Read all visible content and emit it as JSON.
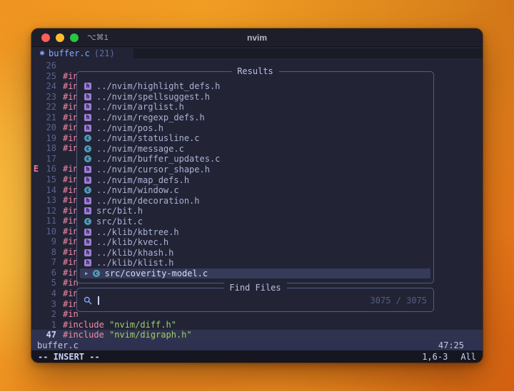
{
  "colors": {
    "bg": "#222436",
    "titlebar": "#1d1e2a",
    "tabfill": "#191b26",
    "cmdbg": "#15161f",
    "statusbg": "#2e3250",
    "border": "#545c7e",
    "fg": "#c8d3f5",
    "dim": "#636da6",
    "linenr": "#5a638c",
    "pink": "#f38ba8",
    "green": "#9ece6a",
    "red": "#f7768e",
    "blue": "#82aaff",
    "selbg": "#363b59",
    "cursorline": "#2f334d",
    "icon_c": "#519aba",
    "icon_h": "#9d7cd8",
    "light_close": "#ff5f57",
    "light_min": "#febc2e",
    "light_zoom": "#28c840"
  },
  "titlebar": {
    "title": "nvim",
    "shortcut": "⌥⌘1"
  },
  "tabline": {
    "icon": "◉",
    "label": "buffer.c",
    "count": "(21)"
  },
  "editor": {
    "lines": [
      {
        "n": "26",
        "parts": []
      },
      {
        "n": "25",
        "parts": [
          {
            "t": "#in",
            "c": "pp"
          }
        ]
      },
      {
        "n": "24",
        "parts": [
          {
            "t": "#in",
            "c": "pp"
          }
        ]
      },
      {
        "n": "23",
        "parts": [
          {
            "t": "#in",
            "c": "pp"
          }
        ]
      },
      {
        "n": "22",
        "parts": [
          {
            "t": "#in",
            "c": "pp"
          }
        ]
      },
      {
        "n": "21",
        "parts": [
          {
            "t": "#in",
            "c": "pp"
          }
        ]
      },
      {
        "n": "20",
        "parts": [
          {
            "t": "#in",
            "c": "pp"
          }
        ]
      },
      {
        "n": "19",
        "parts": [
          {
            "t": "#in",
            "c": "pp"
          }
        ]
      },
      {
        "n": "18",
        "parts": [
          {
            "t": "#in",
            "c": "pp"
          }
        ]
      },
      {
        "n": "17",
        "parts": []
      },
      {
        "n": "16",
        "sign": "E",
        "parts": [
          {
            "t": "#in",
            "c": "pp"
          }
        ]
      },
      {
        "n": "15",
        "parts": [
          {
            "t": "#in",
            "c": "pp"
          }
        ]
      },
      {
        "n": "14",
        "parts": [
          {
            "t": "#in",
            "c": "pp"
          }
        ]
      },
      {
        "n": "13",
        "parts": [
          {
            "t": "#in",
            "c": "pp"
          }
        ]
      },
      {
        "n": "12",
        "parts": [
          {
            "t": "#in",
            "c": "pp"
          }
        ]
      },
      {
        "n": "11",
        "parts": [
          {
            "t": "#in",
            "c": "pp"
          }
        ]
      },
      {
        "n": "10",
        "parts": [
          {
            "t": "#in",
            "c": "pp"
          }
        ]
      },
      {
        "n": "9",
        "parts": [
          {
            "t": "#in",
            "c": "pp"
          }
        ]
      },
      {
        "n": "8",
        "parts": [
          {
            "t": "#in",
            "c": "pp"
          }
        ]
      },
      {
        "n": "7",
        "parts": [
          {
            "t": "#in",
            "c": "pp"
          }
        ]
      },
      {
        "n": "6",
        "parts": [
          {
            "t": "#in",
            "c": "pp"
          }
        ]
      },
      {
        "n": "5",
        "parts": [
          {
            "t": "#in",
            "c": "pp"
          }
        ]
      },
      {
        "n": "4",
        "parts": [
          {
            "t": "#in",
            "c": "pp"
          }
        ]
      },
      {
        "n": "3",
        "parts": [
          {
            "t": "#in",
            "c": "pp"
          }
        ]
      },
      {
        "n": "2",
        "parts": [
          {
            "t": "#in",
            "c": "pp"
          }
        ]
      },
      {
        "n": "1",
        "parts": [
          {
            "t": "#include",
            "c": "pp"
          },
          {
            "t": " \"nvim/diff.h\"",
            "c": "str"
          }
        ]
      },
      {
        "n": "47",
        "current": true,
        "parts": [
          {
            "t": "#include",
            "c": "pp"
          },
          {
            "t": " \"nvim/digraph.h\"",
            "c": "str"
          }
        ]
      }
    ]
  },
  "results": {
    "title": "Results",
    "selected_prefix": "▸",
    "items": [
      {
        "icon": "h",
        "label": "../nvim/highlight_defs.h"
      },
      {
        "icon": "h",
        "label": "../nvim/spellsuggest.h"
      },
      {
        "icon": "h",
        "label": "../nvim/arglist.h"
      },
      {
        "icon": "h",
        "label": "../nvim/regexp_defs.h"
      },
      {
        "icon": "h",
        "label": "../nvim/pos.h"
      },
      {
        "icon": "c",
        "label": "../nvim/statusline.c"
      },
      {
        "icon": "c",
        "label": "../nvim/message.c"
      },
      {
        "icon": "c",
        "label": "../nvim/buffer_updates.c"
      },
      {
        "icon": "h",
        "label": "../nvim/cursor_shape.h"
      },
      {
        "icon": "h",
        "label": "../nvim/map_defs.h"
      },
      {
        "icon": "c",
        "label": "../nvim/window.c"
      },
      {
        "icon": "h",
        "label": "../nvim/decoration.h"
      },
      {
        "icon": "h",
        "label": "src/bit.h"
      },
      {
        "icon": "c",
        "label": "src/bit.c"
      },
      {
        "icon": "h",
        "label": "../klib/kbtree.h"
      },
      {
        "icon": "h",
        "label": "../klib/kvec.h"
      },
      {
        "icon": "h",
        "label": "../klib/khash.h"
      },
      {
        "icon": "h",
        "label": "../klib/klist.h"
      },
      {
        "icon": "c",
        "label": "src/coverity-model.c",
        "selected": true
      }
    ]
  },
  "prompt": {
    "title": "Find Files",
    "counter": "3075 / 3075"
  },
  "statusline": {
    "file": "buffer.c",
    "position": "47:25"
  },
  "cmdline": {
    "mode": "-- INSERT --",
    "ruler": "1,6-3",
    "scroll": "All"
  }
}
